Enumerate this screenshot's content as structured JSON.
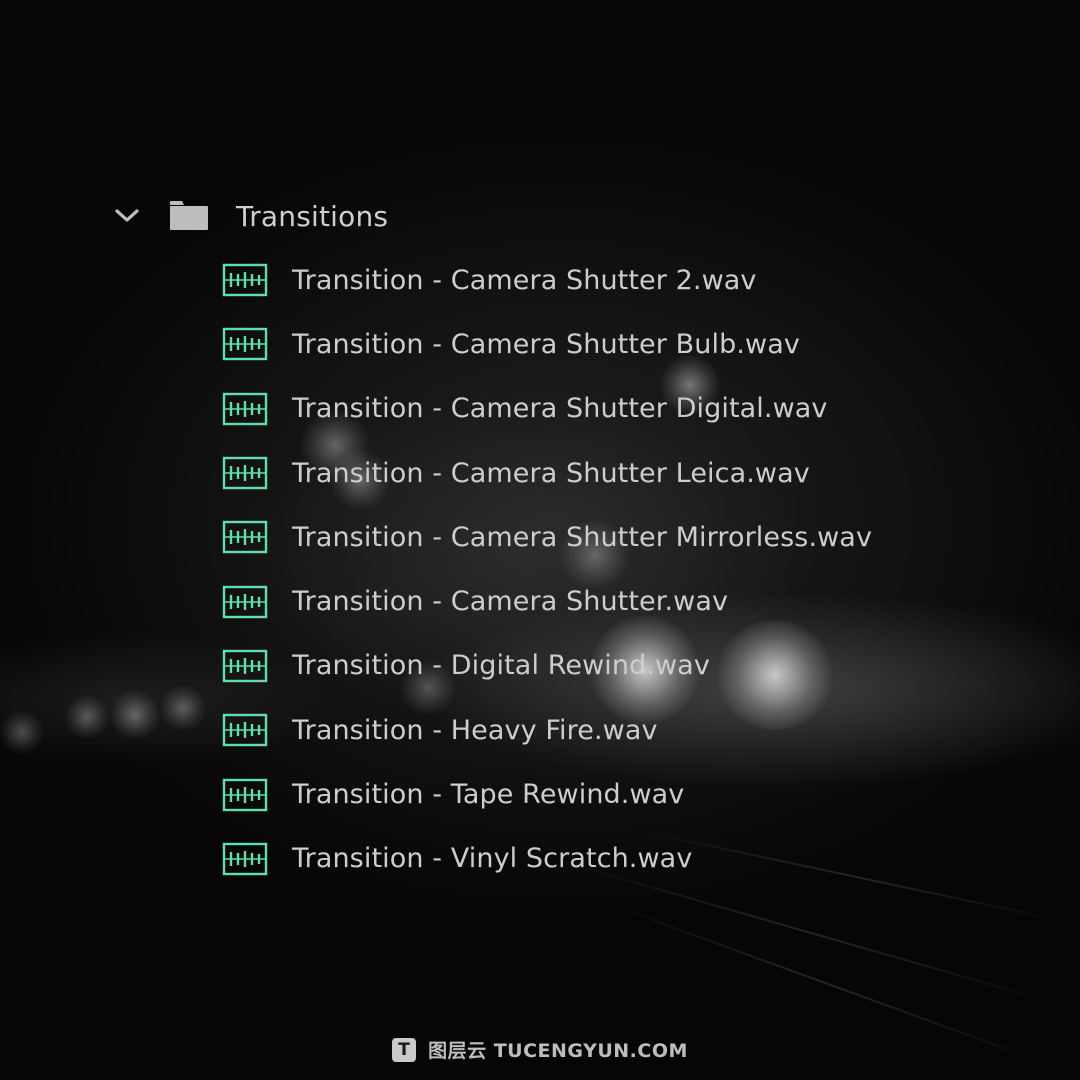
{
  "folder": {
    "name": "Transitions",
    "expanded": true,
    "chevron_icon": "chevron-down-icon",
    "folder_icon": "folder-icon"
  },
  "files": [
    {
      "name": "Transition - Camera Shutter 2.wav",
      "icon": "audio-clip-icon"
    },
    {
      "name": "Transition - Camera Shutter Bulb.wav",
      "icon": "audio-clip-icon"
    },
    {
      "name": "Transition - Camera Shutter Digital.wav",
      "icon": "audio-clip-icon"
    },
    {
      "name": "Transition - Camera Shutter Leica.wav",
      "icon": "audio-clip-icon"
    },
    {
      "name": "Transition - Camera Shutter Mirrorless.wav",
      "icon": "audio-clip-icon"
    },
    {
      "name": "Transition - Camera Shutter.wav",
      "icon": "audio-clip-icon"
    },
    {
      "name": "Transition - Digital Rewind.wav",
      "icon": "audio-clip-icon"
    },
    {
      "name": "Transition - Heavy Fire.wav",
      "icon": "audio-clip-icon"
    },
    {
      "name": "Transition - Tape Rewind.wav",
      "icon": "audio-clip-icon"
    },
    {
      "name": "Transition - Vinyl Scratch.wav",
      "icon": "audio-clip-icon"
    }
  ],
  "colors": {
    "audio_icon": "#5ee0a8",
    "text": "#cdcdcd",
    "folder": "#bdbdbd"
  },
  "watermark": {
    "text": "图层云 TUCENGYUN.COM",
    "logo_letter": "T"
  }
}
